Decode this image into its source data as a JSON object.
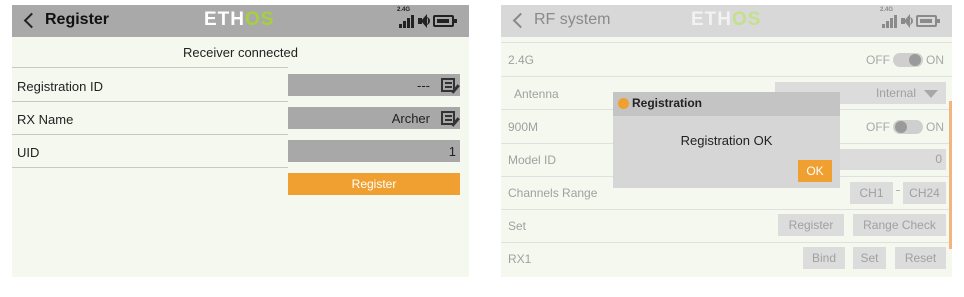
{
  "left": {
    "title": "Register",
    "logo_main": "ETH",
    "logo_accent": "OS",
    "status_signal_label": "2.4G",
    "connection_status": "Receiver connected",
    "registration_id": {
      "label": "Registration ID",
      "value": "---"
    },
    "rx_name": {
      "label": "RX Name",
      "value": "Archer"
    },
    "uid": {
      "label": "UID",
      "value": "1"
    },
    "register_button": "Register"
  },
  "right": {
    "title": "RF system",
    "logo_main": "ETH",
    "logo_accent": "OS",
    "status_signal_label": "2.4G",
    "band_24": {
      "label": "2.4G",
      "off": "OFF",
      "on": "ON",
      "state": "on"
    },
    "antenna": {
      "label": "Antenna",
      "value": "Internal"
    },
    "band_900": {
      "label": "900M",
      "off": "OFF",
      "on": "ON",
      "state": "off"
    },
    "model_id": {
      "label": "Model ID",
      "value": "0"
    },
    "channels_range": {
      "label": "Channels Range",
      "from": "CH1",
      "to": "CH24"
    },
    "set_row": {
      "label": "Set",
      "register": "Register",
      "range_check": "Range Check"
    },
    "rx1_row": {
      "label": "RX1",
      "bind": "Bind",
      "set": "Set",
      "reset": "Reset"
    },
    "dialog": {
      "title": "Registration",
      "message": "Registration OK",
      "ok": "OK"
    }
  },
  "colors": {
    "accent": "#f0a030",
    "logo_green": "#a6d03c",
    "titlebar": "#a9a9a9",
    "screen_bg": "#f5f8ef"
  }
}
